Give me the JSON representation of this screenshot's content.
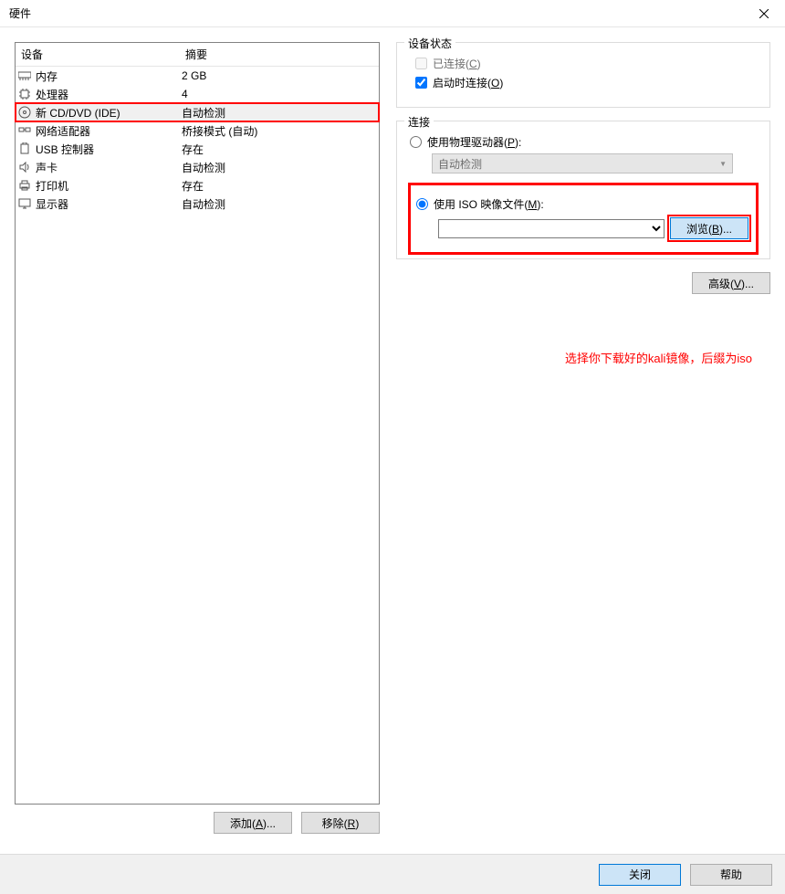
{
  "titlebar": {
    "title": "硬件"
  },
  "left": {
    "header_device": "设备",
    "header_summary": "摘要",
    "rows": [
      {
        "name": "内存",
        "summary": "2 GB",
        "icon": "memory"
      },
      {
        "name": "处理器",
        "summary": "4",
        "icon": "cpu"
      },
      {
        "name": "新 CD/DVD (IDE)",
        "summary": "自动检测",
        "icon": "disc",
        "selected": true,
        "highlight": true
      },
      {
        "name": "网络适配器",
        "summary": "桥接模式 (自动)",
        "icon": "network"
      },
      {
        "name": "USB 控制器",
        "summary": "存在",
        "icon": "usb"
      },
      {
        "name": "声卡",
        "summary": "自动检测",
        "icon": "sound"
      },
      {
        "name": "打印机",
        "summary": "存在",
        "icon": "printer"
      },
      {
        "name": "显示器",
        "summary": "自动检测",
        "icon": "display"
      }
    ],
    "add_label": "添加(A)...",
    "remove_label": "移除(R)"
  },
  "right": {
    "device_status": {
      "legend": "设备状态",
      "connected_label": "已连接(C)",
      "connect_on_power_label": "启动时连接(O)"
    },
    "connection": {
      "legend": "连接",
      "use_physical_label": "使用物理驱动器(P):",
      "physical_combo_value": "自动检测",
      "use_iso_label": "使用 ISO 映像文件(M):",
      "browse_label": "浏览(B)..."
    },
    "advanced_label": "高级(V)...",
    "annotation": "选择你下载好的kali镜像，后缀为iso"
  },
  "bottom": {
    "close_label": "关闭",
    "help_label": "帮助"
  }
}
